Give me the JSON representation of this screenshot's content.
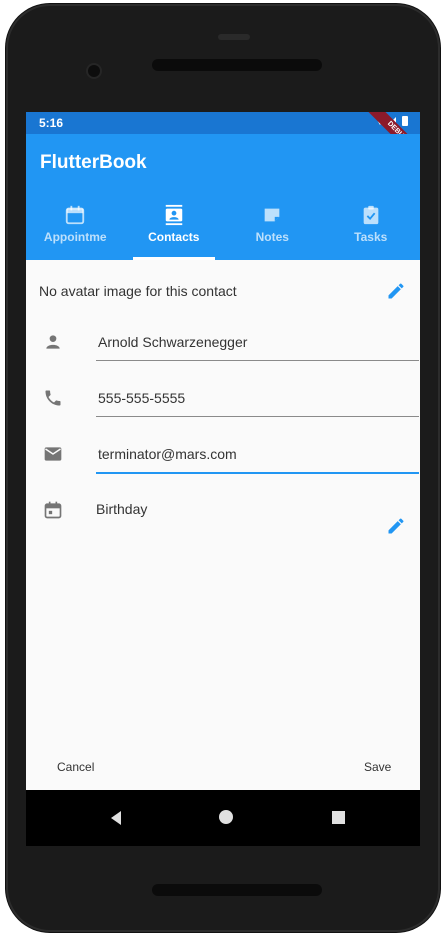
{
  "status_bar": {
    "time": "5:16",
    "debug_label": "DEBUG"
  },
  "app": {
    "title": "FlutterBook"
  },
  "tabs": [
    {
      "label": "Appointme",
      "icon": "calendar-icon",
      "active": false
    },
    {
      "label": "Contacts",
      "icon": "contacts-icon",
      "active": true
    },
    {
      "label": "Notes",
      "icon": "note-icon",
      "active": false
    },
    {
      "label": "Tasks",
      "icon": "task-check-icon",
      "active": false
    }
  ],
  "contact_form": {
    "avatar_text": "No avatar image for this contact",
    "name_value": "Arnold Schwarzenegger",
    "phone_value": "555-555-5555",
    "email_value": "terminator@mars.com",
    "birthday_label": "Birthday"
  },
  "actions": {
    "cancel_label": "Cancel",
    "save_label": "Save"
  },
  "colors": {
    "app_bar": "#2196f3",
    "status_bar": "#1976d2",
    "accent": "#2196f3",
    "background": "#fafafa"
  }
}
